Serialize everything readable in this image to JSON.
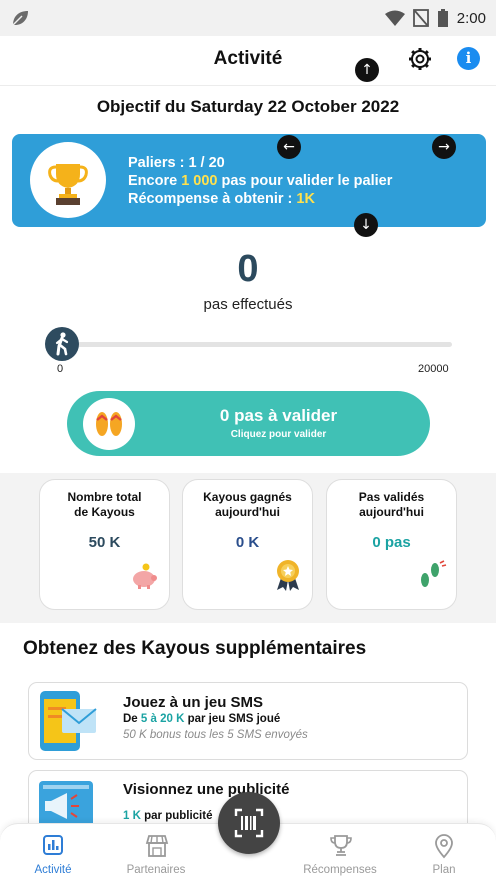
{
  "status_bar": {
    "time": "2:00"
  },
  "header": {
    "title": "Activité"
  },
  "goal": {
    "title": "Objectif du Saturday 22 October 2022"
  },
  "tier": {
    "line1": "Paliers : 1 / 20",
    "line2_prefix": "Encore ",
    "line2_value": "1 000",
    "line2_suffix": " pas pour valider le palier",
    "line3_prefix": "Récompense à obtenir : ",
    "line3_value": "1K"
  },
  "steps": {
    "count": "0",
    "label": "pas effectués"
  },
  "slider": {
    "min": "0",
    "max": "20000",
    "progress": 0
  },
  "validate": {
    "main": "0 pas à valider",
    "sub": "Cliquez pour valider"
  },
  "stats": [
    {
      "label": "Nombre total de Kayous",
      "value": "50 K",
      "color": "#2c4a5e"
    },
    {
      "label": "Kayous gagnés aujourd'hui",
      "value": "0 K",
      "color": "#2a4e8c"
    },
    {
      "label": "Pas validés aujourd'hui",
      "value": "0 pas",
      "color": "#1ba3a3"
    }
  ],
  "section": {
    "title": "Obtenez des Kayous supplémentaires"
  },
  "offers": [
    {
      "title": "Jouez à un jeu SMS",
      "line_prefix": "De ",
      "line_value": "5 à 20 K",
      "line_suffix": " par jeu SMS joué",
      "note": "50 K bonus tous les 5 SMS envoyés"
    },
    {
      "title": "Visionnez une publicité",
      "line_value": "1 K",
      "line_suffix": " par publicité"
    }
  ],
  "nav": {
    "items": [
      {
        "label": "Activité",
        "icon": "chart-icon",
        "active": true
      },
      {
        "label": "Partenaires",
        "icon": "store-icon",
        "active": false
      },
      {
        "label": "Récompenses",
        "icon": "trophy-icon",
        "active": false
      },
      {
        "label": "Plan",
        "icon": "map-pin-icon",
        "active": false
      }
    ],
    "scan_icon": "scan-icon"
  },
  "colors": {
    "primary": "#2f9ed8",
    "teal": "#40c1b5",
    "dark": "#2e4b5f",
    "accent_yellow": "#ffe14d",
    "nav_active": "#2e7dd6"
  }
}
